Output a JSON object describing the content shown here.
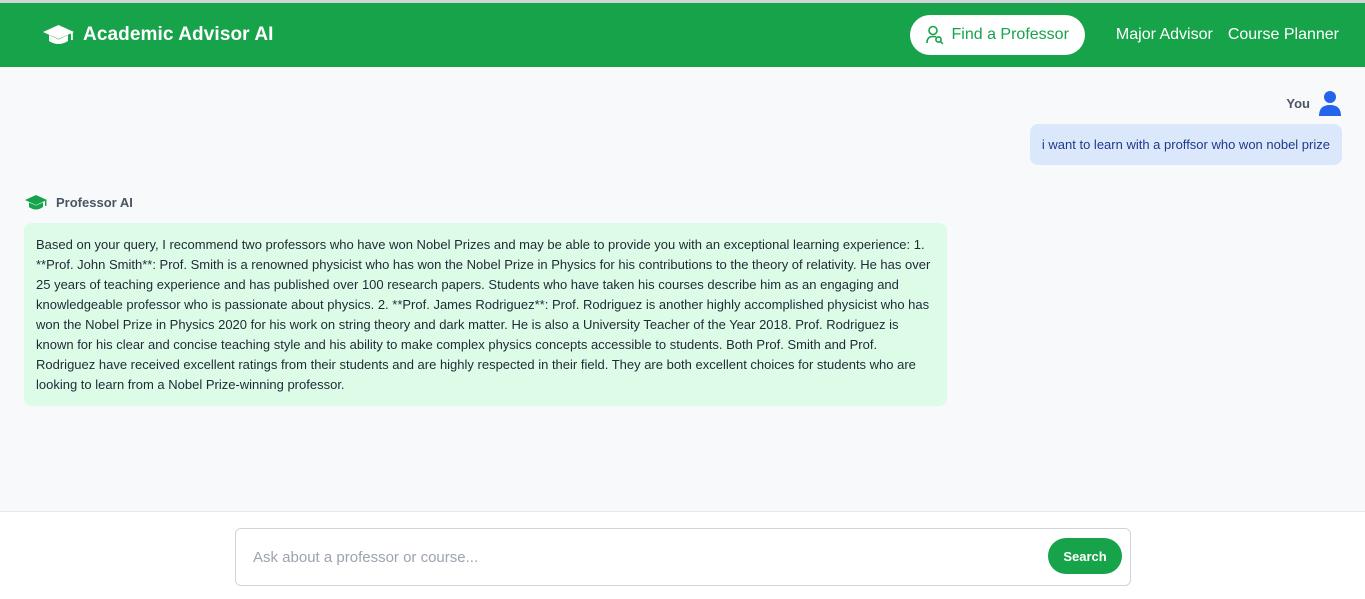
{
  "header": {
    "title": "Academic Advisor AI",
    "brand_icon": "graduation-cap-icon",
    "nav": {
      "find_professor": "Find a Professor",
      "major_advisor": "Major Advisor",
      "course_planner": "Course Planner"
    }
  },
  "colors": {
    "brand_green": "#17a34a",
    "user_bubble": "#dbe8fc",
    "ai_bubble": "#dcfce7",
    "user_icon": "#2563eb"
  },
  "chat": {
    "user_label": "You",
    "user_message": "i want to learn with a proffsor who won nobel prize",
    "ai_label": "Professor AI",
    "ai_message": "Based on your query, I recommend two professors who have won Nobel Prizes and may be able to provide you with an exceptional learning experience: 1. **Prof. John Smith**: Prof. Smith is a renowned physicist who has won the Nobel Prize in Physics for his contributions to the theory of relativity. He has over 25 years of teaching experience and has published over 100 research papers. Students who have taken his courses describe him as an engaging and knowledgeable professor who is passionate about physics. 2. **Prof. James Rodriguez**: Prof. Rodriguez is another highly accomplished physicist who has won the Nobel Prize in Physics 2020 for his work on string theory and dark matter. He is also a University Teacher of the Year 2018. Prof. Rodriguez is known for his clear and concise teaching style and his ability to make complex physics concepts accessible to students. Both Prof. Smith and Prof. Rodriguez have received excellent ratings from their students and are highly respected in their field. They are both excellent choices for students who are looking to learn from a Nobel Prize-winning professor."
  },
  "search": {
    "placeholder": "Ask about a professor or course...",
    "value": "",
    "button_label": "Search"
  }
}
